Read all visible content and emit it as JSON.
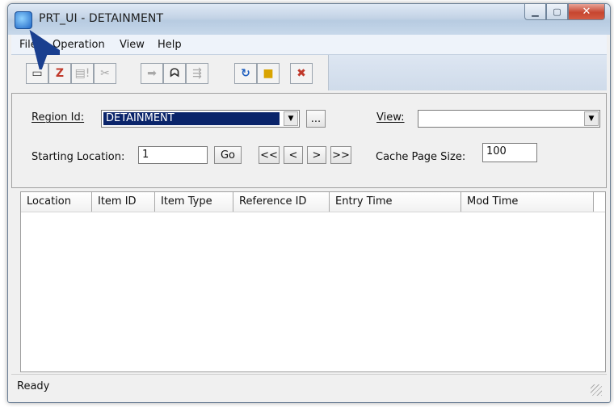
{
  "window": {
    "title": "PRT_UI - DETAINMENT"
  },
  "menu": {
    "items": [
      "File",
      "Operation",
      "View",
      "Help"
    ]
  },
  "toolbar": {
    "buttons": [
      {
        "name": "new-doc-icon",
        "glyph": "▭"
      },
      {
        "name": "calendar-icon",
        "glyph": "Z"
      },
      {
        "name": "doc-alert-icon",
        "glyph": "!"
      },
      {
        "name": "cut-icon",
        "glyph": "✂"
      },
      {
        "name": "forward-arrow-icon",
        "glyph": "➡"
      },
      {
        "name": "binoculars-icon",
        "glyph": "🔭"
      },
      {
        "name": "find-next-icon",
        "glyph": "↯"
      },
      {
        "name": "refresh-icon",
        "glyph": "↻"
      },
      {
        "name": "lock-icon",
        "glyph": "🔒"
      },
      {
        "name": "delete-icon",
        "glyph": "✖"
      }
    ]
  },
  "filters": {
    "region_label": "Region Id:",
    "region_value": "DETAINMENT",
    "browse_label": "...",
    "view_label": "View:",
    "view_value": "",
    "start_label": "Starting Location:",
    "start_value": "1",
    "go_label": "Go",
    "first_label": "<<",
    "prev_label": "<",
    "next_label": ">",
    "last_label": ">>",
    "cache_label": "Cache Page Size:",
    "cache_value": "100"
  },
  "table": {
    "columns": [
      "Location",
      "Item ID",
      "Item Type",
      "Reference ID",
      "Entry Time",
      "Mod Time"
    ],
    "rows": []
  },
  "status": {
    "text": "Ready"
  },
  "colors": {
    "selection": "#0a246a",
    "titlebar": "#c3d3e6",
    "pointer_arrow": "#1a3f8f"
  }
}
